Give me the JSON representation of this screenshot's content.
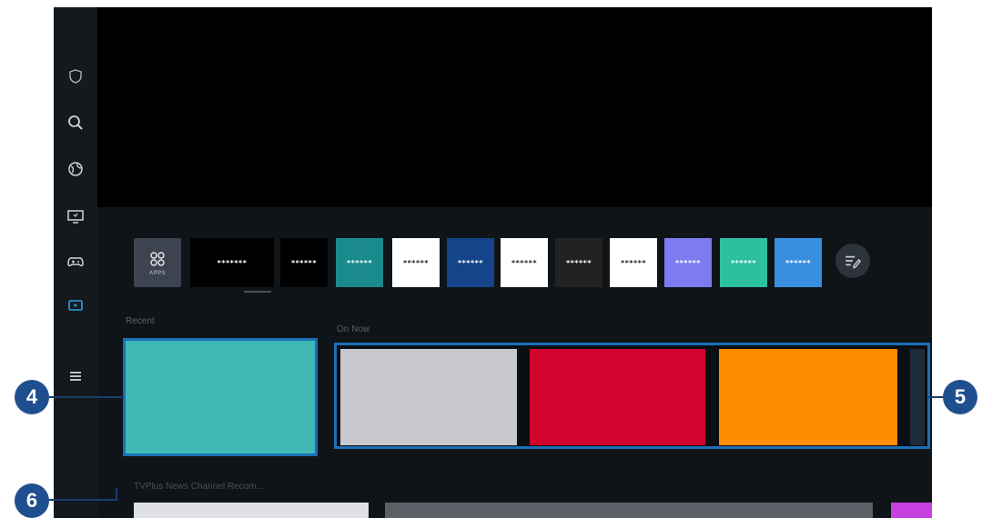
{
  "sidebar": {
    "icons": [
      "shield-icon",
      "search-icon",
      "globe-icon",
      "tv-icon",
      "gamepad-icon",
      "media-icon",
      "menu-icon"
    ]
  },
  "apps": {
    "apps_label": "APPS",
    "items": [
      {
        "label": "*******",
        "bg": "#000000",
        "fg": "#ffffff"
      },
      {
        "label": "******",
        "bg": "#000000",
        "fg": "#ffffff"
      },
      {
        "label": "******",
        "bg": "#1a8a8c",
        "fg": "#ffffff"
      },
      {
        "label": "******",
        "bg": "#ffffff",
        "fg": "#222222"
      },
      {
        "label": "******",
        "bg": "#14448a",
        "fg": "#ffffff"
      },
      {
        "label": "******",
        "bg": "#ffffff",
        "fg": "#222222"
      },
      {
        "label": "******",
        "bg": "#222222",
        "fg": "#ffffff"
      },
      {
        "label": "******",
        "bg": "#ffffff",
        "fg": "#222222"
      },
      {
        "label": "******",
        "bg": "#7c7cf0",
        "fg": "#ffffff"
      },
      {
        "label": "******",
        "bg": "#2cc0a0",
        "fg": "#ffffff"
      },
      {
        "label": "******",
        "bg": "#3a8ee0",
        "fg": "#ffffff"
      }
    ]
  },
  "sections": {
    "recent_label": "Recent",
    "on_now_label": "On Now",
    "bottom_label": "TVPlus News Channel Recom..."
  },
  "on_now_tiles": [
    {
      "color": "#c8c9ce"
    },
    {
      "color": "#d2042d"
    },
    {
      "color": "#ff8c00"
    }
  ],
  "callouts": {
    "recent": "4",
    "on_now": "5",
    "row": "6"
  },
  "colors": {
    "accent": "#1c6fb8",
    "recent": "#40b9b4",
    "callout": "#1f4f8e"
  }
}
